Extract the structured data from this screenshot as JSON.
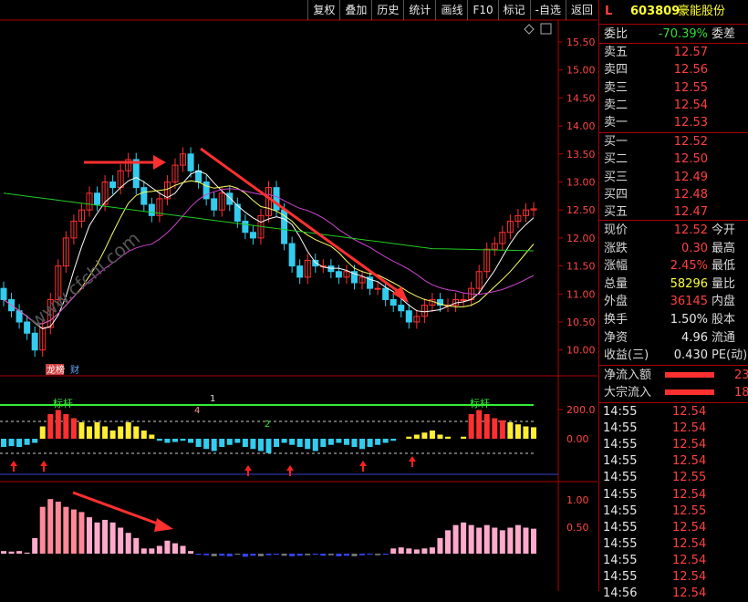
{
  "toolbar": [
    "复权",
    "叠加",
    "历史",
    "统计",
    "画线",
    "F10",
    "标记",
    "-自选",
    "返回"
  ],
  "stock": {
    "flag": "L",
    "code": "603809",
    "name": "豪能股份"
  },
  "weibi": {
    "label": "委比",
    "value": "-70.39%",
    "right": "委差"
  },
  "asks": [
    {
      "label": "卖五",
      "price": "12.57"
    },
    {
      "label": "卖四",
      "price": "12.56"
    },
    {
      "label": "卖三",
      "price": "12.55"
    },
    {
      "label": "卖二",
      "price": "12.54"
    },
    {
      "label": "卖一",
      "price": "12.53"
    }
  ],
  "bids": [
    {
      "label": "买一",
      "price": "12.52"
    },
    {
      "label": "买二",
      "price": "12.50"
    },
    {
      "label": "买三",
      "price": "12.49"
    },
    {
      "label": "买四",
      "price": "12.48"
    },
    {
      "label": "买五",
      "price": "12.47"
    }
  ],
  "stats": [
    {
      "label": "现价",
      "value": "12.52",
      "right": "今开",
      "color": "red"
    },
    {
      "label": "涨跌",
      "value": "0.30",
      "right": "最高",
      "color": "red"
    },
    {
      "label": "涨幅",
      "value": "2.45%",
      "right": "最低",
      "color": "red"
    },
    {
      "label": "总量",
      "value": "58296",
      "right": "量比",
      "color": "yellow"
    },
    {
      "label": "外盘",
      "value": "36145",
      "right": "内盘",
      "color": "red"
    },
    {
      "label": "换手",
      "value": "1.50%",
      "right": "股本",
      "color": "white"
    },
    {
      "label": "净资",
      "value": "4.96",
      "right": "流通",
      "color": "white"
    },
    {
      "label": "收益(三)",
      "value": "0.430",
      "right": "PE(动)",
      "color": "white"
    }
  ],
  "flows": [
    {
      "label": "净流入额",
      "value": "23"
    },
    {
      "label": "大宗流入",
      "value": "18"
    }
  ],
  "trades": [
    {
      "time": "14:55",
      "price": "12.54"
    },
    {
      "time": "14:55",
      "price": "12.54"
    },
    {
      "time": "14:55",
      "price": "12.54"
    },
    {
      "time": "14:55",
      "price": "12.54"
    },
    {
      "time": "14:55",
      "price": "12.55"
    },
    {
      "time": "14:55",
      "price": "12.54"
    },
    {
      "time": "14:55",
      "price": "12.55"
    },
    {
      "time": "14:55",
      "price": "12.54"
    },
    {
      "time": "14:55",
      "price": "12.54"
    },
    {
      "time": "14:55",
      "price": "12.54"
    },
    {
      "time": "14:55",
      "price": "12.54"
    },
    {
      "time": "14:56",
      "price": "12.54"
    }
  ],
  "price_axis": [
    "15.50",
    "15.00",
    "14.50",
    "14.00",
    "13.50",
    "13.00",
    "12.50",
    "12.00",
    "11.50",
    "11.00",
    "10.50",
    "10.00"
  ],
  "ind1_axis": [
    "200.0",
    "0.00"
  ],
  "ind2_axis": [
    "1.00",
    "0.50"
  ],
  "chart_labels": {
    "badge1": "龙榜",
    "badge2": "财",
    "mark1": "标杆",
    "mark2": "标杆",
    "num1": "1",
    "num2": "2",
    "num4": "4"
  },
  "watermark": "www.cfchi.com"
}
